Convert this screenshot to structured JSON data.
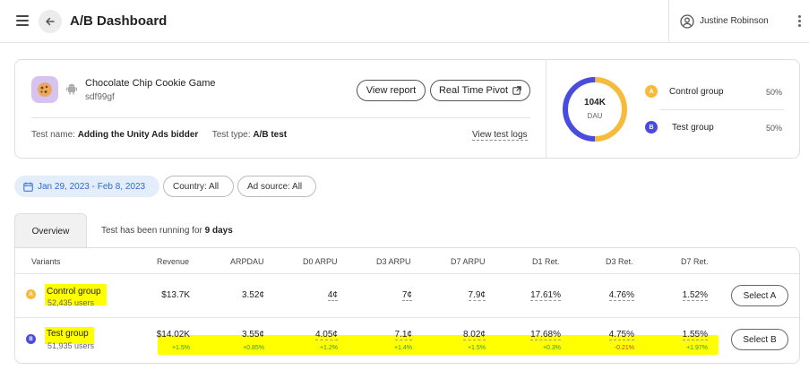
{
  "header": {
    "title": "A/B Dashboard",
    "user_name": "Justine Robinson"
  },
  "game": {
    "name": "Chocolate Chip Cookie Game",
    "id": "sdf99gf",
    "view_report_label": "View report",
    "real_time_pivot_label": "Real Time Pivot",
    "test_name_label": "Test name:",
    "test_name_value": "Adding the Unity Ads bidder",
    "test_type_label": "Test type:",
    "test_type_value": "A/B test",
    "view_logs_label": "View test logs"
  },
  "summary": {
    "dau_value": "104K",
    "dau_label": "DAU",
    "split_fraction_a": 0.5,
    "groups": [
      {
        "badge": "A",
        "label": "Control group",
        "pct": "50%",
        "color": "#f7bb3b"
      },
      {
        "badge": "B",
        "label": "Test group",
        "pct": "50%",
        "color": "#4a4be0"
      }
    ]
  },
  "filters": {
    "date_range": "Jan 29, 2023 - Feb 8, 2023",
    "country": "Country: All",
    "ad_source": "Ad source: All"
  },
  "tabs": {
    "overview": "Overview",
    "running_prefix": "Test has been running for",
    "running_days": "9 days"
  },
  "table": {
    "headers": [
      "Variants",
      "Revenue",
      "ARPDAU",
      "D0 ARPU",
      "D3 ARPU",
      "D7 ARPU",
      "D1 Ret.",
      "D3 Ret.",
      "D7 Ret."
    ],
    "rows": [
      {
        "badge": "A",
        "name": "Control group",
        "users": "52,435 users",
        "values": [
          "$13.7K",
          "3.52¢",
          "4¢",
          "7¢",
          "7.9¢",
          "17.61%",
          "4.76%",
          "1.52%"
        ],
        "deltas": [],
        "select_label": "Select A"
      },
      {
        "badge": "B",
        "name": "Test group",
        "users": "51,935 users",
        "values": [
          "$14.02K",
          "3.55¢",
          "4.05¢",
          "7.1¢",
          "8.02¢",
          "17.68%",
          "4.75%",
          "1.55%"
        ],
        "deltas": [
          "+1.5%",
          "+0.85%",
          "+1.2%",
          "+1.4%",
          "+1.5%",
          "+0.3%",
          "-0.21%",
          "+1.97%"
        ],
        "select_label": "Select B"
      }
    ]
  },
  "colors": {
    "control": "#f7bb3b",
    "test": "#4a4be0",
    "highlight": "#ffff00",
    "accent_blue": "#2d6ad6"
  }
}
